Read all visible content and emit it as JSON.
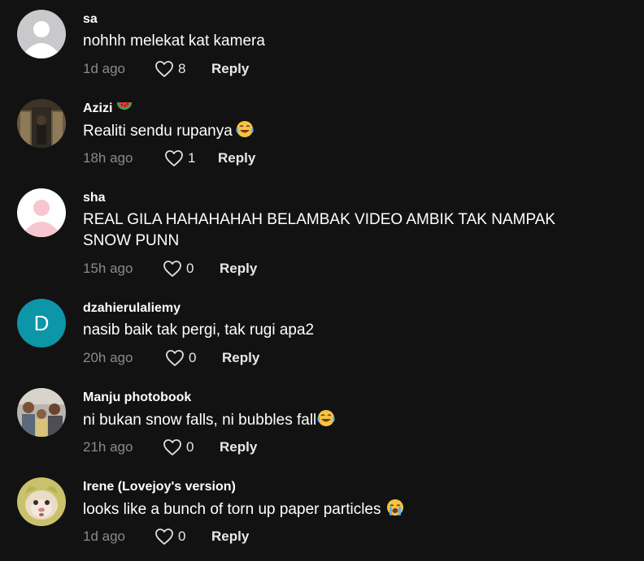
{
  "colors": {
    "background": "#121212",
    "username": "#ffffff",
    "comment_text": "#ffffff",
    "timestamp": "#8a8a8a",
    "reply": "#e8e8e8",
    "avatar_d_bg": "#0d95a8",
    "avatar_sha_bg": "#ffffff"
  },
  "comments": [
    {
      "username": "sa",
      "avatar_icon": "default-avatar-icon",
      "text": "nohhh melekat kat kamera",
      "time": "1d ago",
      "likes": "8",
      "reply_label": "Reply"
    },
    {
      "username": "Azizi",
      "username_badge_icon": "watermelon-icon",
      "avatar_icon": "photo-avatar-icon",
      "text": "Realiti sendu rupanya",
      "text_emoji_icon": "laughing-tears-emoji-icon",
      "time": "18h ago",
      "likes": "1",
      "reply_label": "Reply"
    },
    {
      "username": "sha",
      "avatar_icon": "pink-default-avatar-icon",
      "text": "REAL GILA HAHAHAHAH BELAMBAK VIDEO AMBIK TAK NAMPAK SNOW PUNN",
      "time": "15h ago",
      "likes": "0",
      "reply_label": "Reply"
    },
    {
      "username": "dzahierulaliemy",
      "avatar_letter": "D",
      "text": "nasib baik tak pergi, tak rugi apa2",
      "time": "20h ago",
      "likes": "0",
      "reply_label": "Reply"
    },
    {
      "username": "Manju photobook",
      "avatar_icon": "photo-avatar-icon",
      "text": "ni bukan snow falls, ni bubbles fall",
      "text_emoji_icon": "laughing-tears-emoji-icon",
      "time": "21h ago",
      "likes": "0",
      "reply_label": "Reply"
    },
    {
      "username": "Irene (Lovejoy's version)",
      "avatar_icon": "cat-photo-avatar-icon",
      "text": "looks like a bunch of torn up paper particles",
      "text_emoji_icon": "crying-emoji-icon",
      "time": "1d ago",
      "likes": "0",
      "reply_label": "Reply"
    }
  ]
}
